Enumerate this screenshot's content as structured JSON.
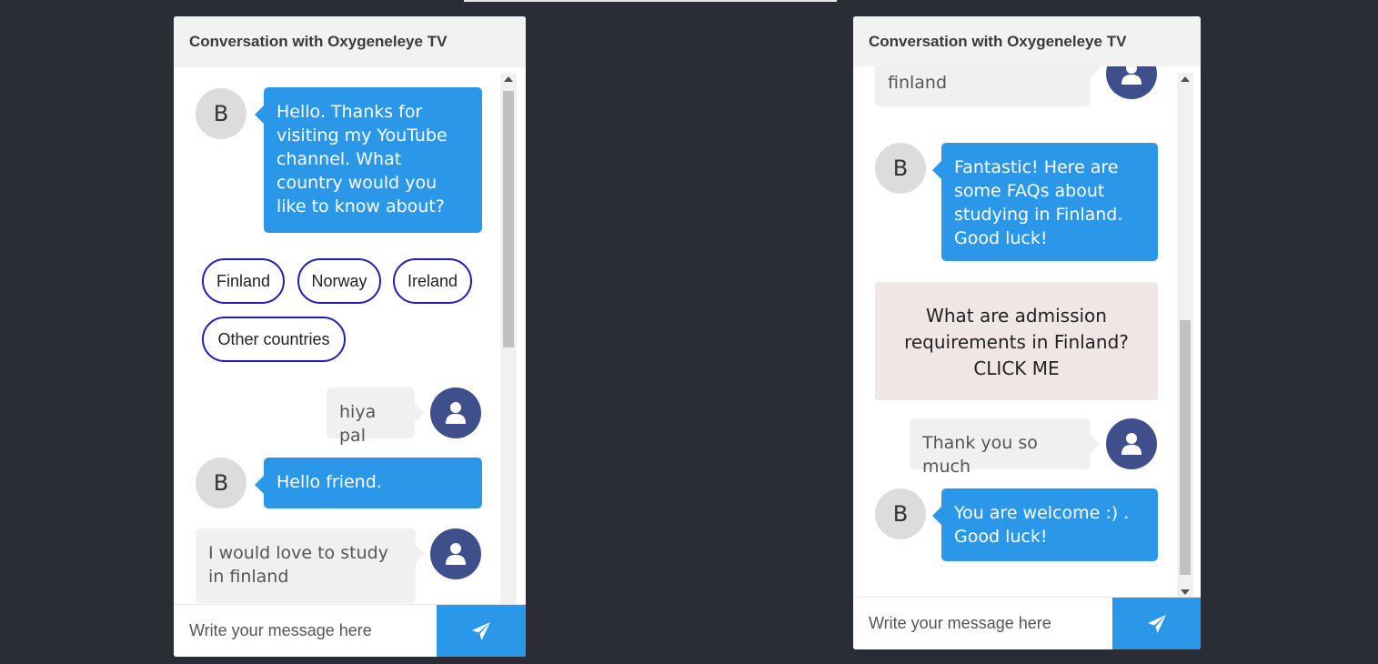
{
  "widgets": [
    {
      "title": "Conversation with Oxygeneleye TV",
      "messages": {
        "bot_greeting": "Hello. Thanks for visiting my YouTube channel. What country would you like to know about?",
        "bot_avatar_letter": "B",
        "chips": [
          "Finland",
          "Norway",
          "Ireland",
          "Other countries"
        ],
        "user_hiya": "hiya pal",
        "bot_avatar_letter_2": "B",
        "bot_friend": "Hello friend.",
        "user_study": "I would love to study in finland"
      },
      "composer": {
        "placeholder": "Write your message here"
      }
    },
    {
      "title": "Conversation with Oxygeneleye TV",
      "messages": {
        "user_study_tail": "finland",
        "bot_avatar_letter": "B",
        "bot_fantastic": "Fantastic! Here are some FAQs about studying in Finland. Good luck!",
        "card_text": "What are admission requirements in Finland? CLICK ME",
        "user_thanks": "Thank you so much",
        "bot_avatar_letter_2": "B",
        "bot_welcome": "You are welcome :) . Good luck!"
      },
      "composer": {
        "placeholder": "Write your message here"
      }
    }
  ],
  "colors": {
    "background": "#2a2d35",
    "bot_bubble": "#2b97e9",
    "user_avatar": "#3e4f8c",
    "chip_border": "#1f1fb8",
    "card": "#f1e6e6"
  },
  "icons": {
    "user_avatar": "user-icon",
    "send": "paper-plane-icon"
  }
}
